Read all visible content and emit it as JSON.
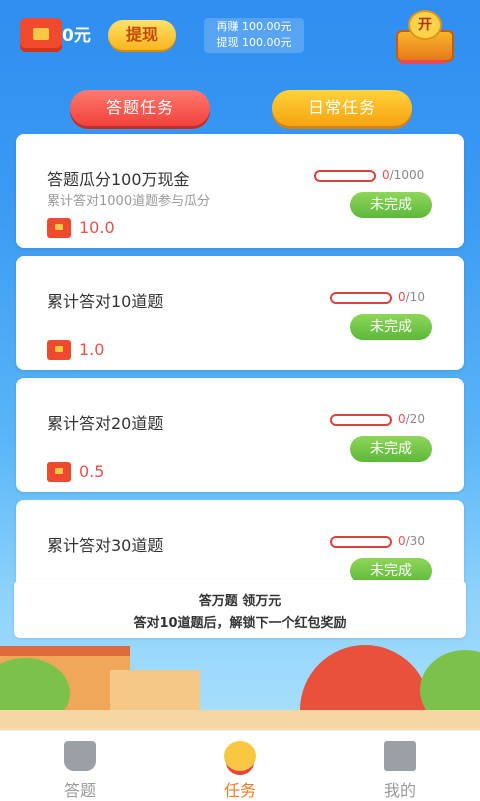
{
  "header": {
    "balance": "0元",
    "withdraw_label": "提现",
    "earned_text": "再赚 100.00元",
    "withdraw_amount_text": "提现 100.00元",
    "chest_label": "开"
  },
  "tabs": {
    "quiz_tasks": "答题任务",
    "daily_tasks": "日常任务"
  },
  "tasks": [
    {
      "title": "答题瓜分100万现金",
      "subtitle": "累计答对1000道题参与瓜分",
      "reward": "10.0",
      "progress_current": "0",
      "progress_total": "/1000",
      "progress_fraction": 0,
      "status": "未完成"
    },
    {
      "title": "累计答对10道题",
      "subtitle": "",
      "reward": "1.0",
      "progress_current": "0",
      "progress_total": "/10",
      "progress_fraction": 0,
      "status": "未完成"
    },
    {
      "title": "累计答对20道题",
      "subtitle": "",
      "reward": "0.5",
      "progress_current": "0",
      "progress_total": "/20",
      "progress_fraction": 0,
      "status": "未完成"
    },
    {
      "title": "累计答对30道题",
      "subtitle": "",
      "reward": "",
      "progress_current": "0",
      "progress_total": "/30",
      "progress_fraction": 0,
      "status": "未完成"
    }
  ],
  "notice": {
    "line1": "答万题 领万元",
    "line2": "答对10道题后，解锁下一个红包奖励"
  },
  "bottom_nav": [
    {
      "label": "答题",
      "icon": "trophy-icon",
      "active": false
    },
    {
      "label": "任务",
      "icon": "medal-icon",
      "active": true
    },
    {
      "label": "我的",
      "icon": "shop-icon",
      "active": false
    }
  ],
  "colors": {
    "accent": "#f07a22",
    "reward": "#e8534a",
    "status_green": "#5cb83a"
  }
}
